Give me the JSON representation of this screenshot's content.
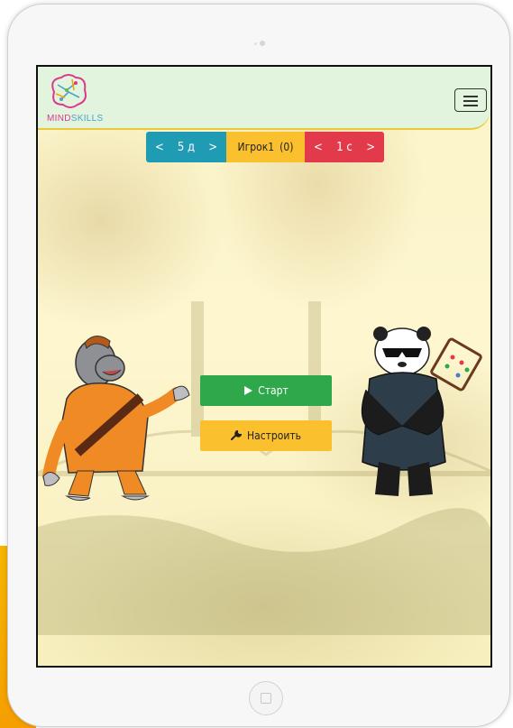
{
  "app": {
    "logo_text_part1": "MIND",
    "logo_text_part2": "SKILLS"
  },
  "controls": {
    "digits": {
      "prev": "<",
      "value": "5 д",
      "next": ">"
    },
    "player": {
      "name": "Игрок1",
      "score": "(0)"
    },
    "time": {
      "prev": "<",
      "value": "1 с",
      "next": ">"
    }
  },
  "buttons": {
    "start_label": "Старт",
    "setup_label": "Настроить"
  },
  "icons": {
    "start": "play-icon",
    "setup": "wrench-icon",
    "menu": "hamburger-icon",
    "logo": "brain-icon"
  },
  "colors": {
    "digits_bg": "#1f9bb4",
    "player_bg": "#fbc02d",
    "time_bg": "#e2394b",
    "start_bg": "#2ea84a",
    "setup_bg": "#fbc02d",
    "header_bg": "#e3f4de"
  }
}
